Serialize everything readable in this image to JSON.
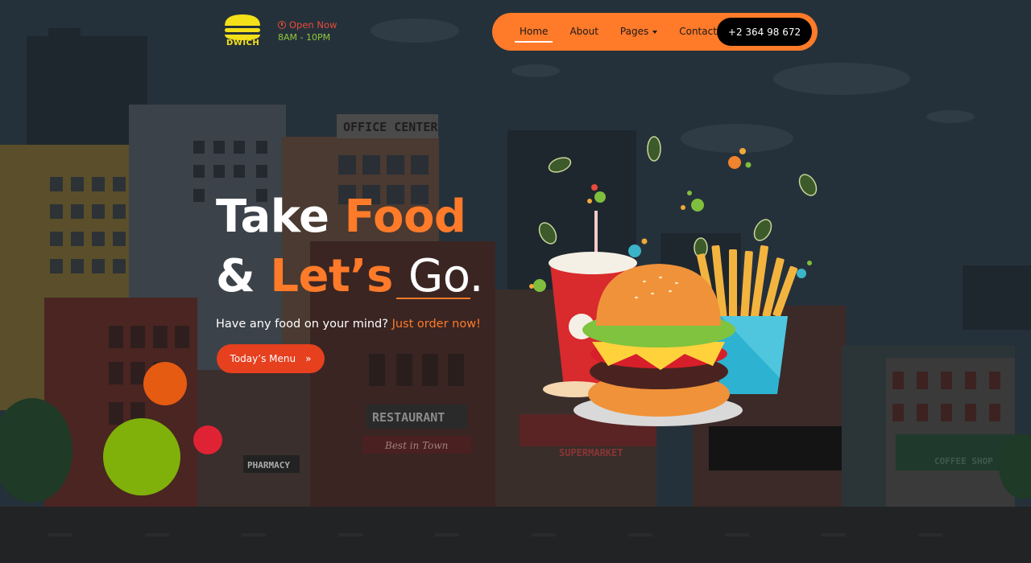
{
  "brand": {
    "name": "DWICH"
  },
  "status": {
    "open_label": "Open Now",
    "hours": "8AM - 10PM"
  },
  "nav": {
    "items": [
      {
        "label": "Home",
        "active": true
      },
      {
        "label": "About",
        "active": false
      },
      {
        "label": "Pages",
        "active": false,
        "dropdown": true
      },
      {
        "label": "Contact",
        "active": false
      }
    ],
    "phone": "+2 364 98 672"
  },
  "hero": {
    "line1_a": "Take",
    "line1_b": "Food",
    "line2_a": "&",
    "line2_b": "Let’s",
    "line2_c": "Go.",
    "subtitle_a": "Have any food on your mind?",
    "subtitle_b": "Just order now!",
    "cta": "Today’s Menu",
    "cta_icon": "»"
  },
  "scene_signs": {
    "office": "OFFICE CENTER",
    "restaurant": "RESTAURANT",
    "best_in_town": "Best in Town",
    "pharmacy": "PHARMACY",
    "supermarket": "SUPERMARKET",
    "coffee": "COFFEE SHOP"
  },
  "colors": {
    "accent": "#ff7a29",
    "cta": "#e6401f",
    "logo_yellow": "#f4e019",
    "green": "#92c73c",
    "red": "#e84a3a"
  }
}
